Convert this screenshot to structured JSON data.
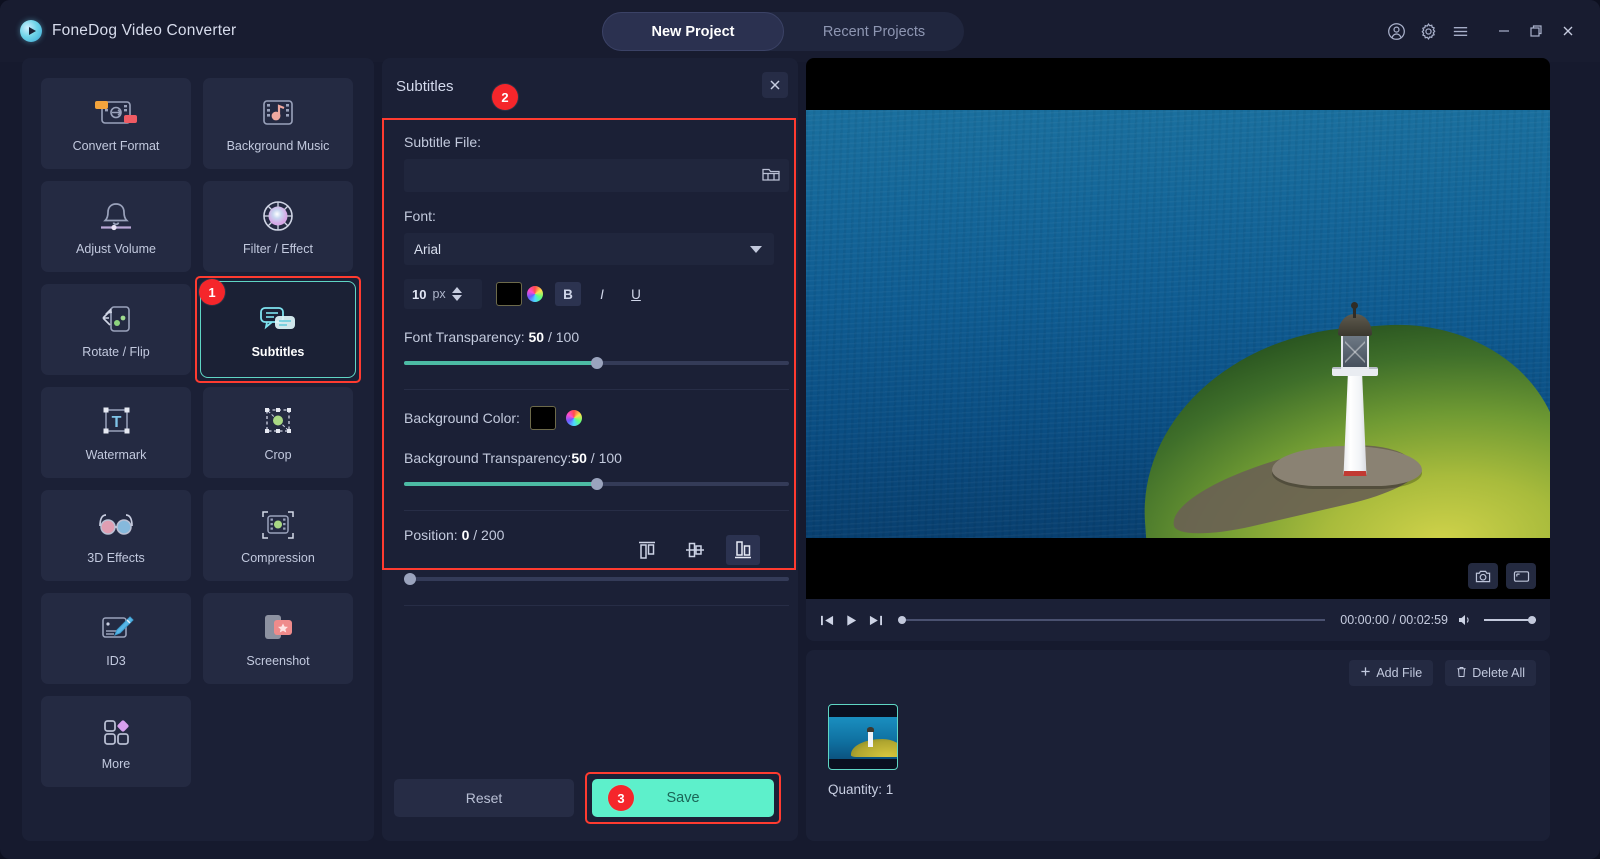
{
  "app": {
    "brand": "FoneDog Video Converter",
    "logo_icon": "play-circle-icon"
  },
  "tabs": [
    {
      "label": "New Project",
      "active": true
    },
    {
      "label": "Recent Projects",
      "active": false
    }
  ],
  "window_controls": [
    {
      "name": "account-icon",
      "glyph": "account"
    },
    {
      "name": "settings-gear-icon",
      "glyph": "gear"
    },
    {
      "name": "menu-icon",
      "glyph": "hamburger"
    },
    {
      "name": "minimize-button",
      "glyph": "minimize"
    },
    {
      "name": "maximize-button",
      "glyph": "maximize"
    },
    {
      "name": "close-button",
      "glyph": "close"
    }
  ],
  "tools": [
    {
      "label": "Convert Format",
      "icon": "convert-format-icon",
      "selected": false
    },
    {
      "label": "Background Music",
      "icon": "background-music-icon",
      "selected": false
    },
    {
      "label": "Adjust Volume",
      "icon": "adjust-volume-icon",
      "selected": false
    },
    {
      "label": "Filter / Effect",
      "icon": "filter-effect-icon",
      "selected": false
    },
    {
      "label": "Rotate / Flip",
      "icon": "rotate-flip-icon",
      "selected": false
    },
    {
      "label": "Subtitles",
      "icon": "subtitles-icon",
      "selected": true
    },
    {
      "label": "Watermark",
      "icon": "watermark-icon",
      "selected": false
    },
    {
      "label": "Crop",
      "icon": "crop-icon",
      "selected": false
    },
    {
      "label": "3D Effects",
      "icon": "3d-effects-icon",
      "selected": false
    },
    {
      "label": "Compression",
      "icon": "compression-icon",
      "selected": false
    },
    {
      "label": "ID3",
      "icon": "id3-icon",
      "selected": false
    },
    {
      "label": "Screenshot",
      "icon": "screenshot-icon",
      "selected": false
    },
    {
      "label": "More",
      "icon": "more-icon",
      "selected": false
    }
  ],
  "steps": {
    "one": "1",
    "two": "2",
    "three": "3"
  },
  "panel": {
    "title": "Subtitles",
    "close_icon": "close-icon",
    "subtitle_file_label": "Subtitle File:",
    "subtitle_file_value": "",
    "subtitle_file_placeholder": "",
    "browse_icon": "folder-icon",
    "font_label": "Font:",
    "font_value": "Arial",
    "font_size_value": "10",
    "font_size_unit": "px",
    "font_color": "#000000",
    "bold_label": "B",
    "italic_label": "I",
    "underline_label": "U",
    "font_transparency_label": "Font Transparency:",
    "font_transparency_value": "50",
    "font_transparency_max": "/ 100",
    "font_transparency_percent": 50,
    "background_color_label": "Background Color:",
    "background_color": "#000000",
    "background_transparency_label": "Background Transparency:",
    "background_transparency_value": "50",
    "background_transparency_max": "/ 100",
    "background_transparency_percent": 50,
    "position_label": "Position:",
    "position_value": "0",
    "position_max": "/ 200",
    "position_percent": 0,
    "align_top_icon": "align-top-icon",
    "align_middle_icon": "align-middle-icon",
    "align_bottom_icon": "align-bottom-icon",
    "reset_label": "Reset",
    "save_label": "Save"
  },
  "preview": {
    "snapshot_icon": "camera-icon",
    "fullscreen_icon": "fullscreen-icon",
    "prev_icon": "previous-frame-icon",
    "play_icon": "play-icon",
    "next_icon": "next-frame-icon",
    "volume_icon": "volume-icon",
    "time_current": "00:00:00",
    "time_total": "00:02:59",
    "time_display": "00:00:00 / 00:02:59",
    "progress_percent": 0,
    "volume_percent": 100
  },
  "filelist": {
    "add_file_label": "Add File",
    "add_file_icon": "plus-icon",
    "delete_all_label": "Delete All",
    "delete_all_icon": "trash-icon",
    "quantity_label": "Quantity: 1",
    "thumbnail_name": "lighthouse-video-thumbnail"
  },
  "colors": {
    "accent_teal": "#5df0cb",
    "highlight_red": "#ff3b30",
    "panel_bg": "#1b2036",
    "card_bg": "#242a42",
    "slider_fill": "#4cbba4"
  }
}
